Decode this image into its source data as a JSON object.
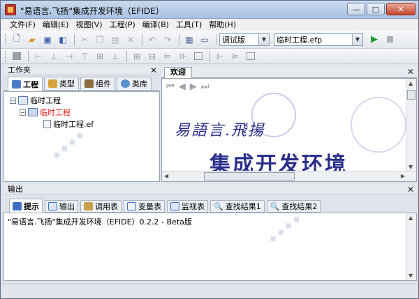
{
  "window": {
    "title": "\"易语言.飞扬\"集成开发环境（EFIDE）"
  },
  "window_controls": {
    "minimize": "—",
    "maximize": "□",
    "close": "✕"
  },
  "menu": [
    "文件(F)",
    "编辑(E)",
    "视图(V)",
    "工程(P)",
    "编译(B)",
    "工具(T)",
    "帮助(H)"
  ],
  "toolbar": {
    "config_combo": "调试版",
    "project_combo": "临时工程.efp",
    "run_glyph": "▶"
  },
  "workspace": {
    "title": "工作夹",
    "tabs": [
      {
        "label": "工程",
        "icon": "project-icon",
        "active": true,
        "color": "#4a7cc7"
      },
      {
        "label": "类型",
        "icon": "type-icon",
        "active": false,
        "color": "#d9a33a"
      },
      {
        "label": "组件",
        "icon": "component-icon",
        "active": false,
        "color": "#8b6a3d"
      },
      {
        "label": "类库",
        "icon": "library-icon",
        "active": false,
        "color": "#5a8fcf"
      }
    ],
    "tree": [
      {
        "label": "临时工程",
        "level": 0,
        "expander": "−",
        "color": "#000000"
      },
      {
        "label": "临时工程",
        "level": 1,
        "expander": "−",
        "color": "#e02020"
      },
      {
        "label": "临时工程.ef",
        "level": 2,
        "expander": "",
        "color": "#000000"
      }
    ]
  },
  "welcome": {
    "tab": "欢迎",
    "logo_small": "易語言.飛揚",
    "logo_big": "集成开发环境"
  },
  "output": {
    "title": "输出",
    "tabs": [
      {
        "label": "提示",
        "icon": "hint-icon",
        "active": true
      },
      {
        "label": "输出",
        "icon": "output-icon",
        "active": false
      },
      {
        "label": "调用表",
        "icon": "callstack-icon",
        "active": false
      },
      {
        "label": "变量表",
        "icon": "variables-icon",
        "active": false
      },
      {
        "label": "监视表",
        "icon": "watch-icon",
        "active": false
      },
      {
        "label": "查找结果1",
        "icon": "find-icon",
        "active": false
      },
      {
        "label": "查找结果2",
        "icon": "find-icon",
        "active": false
      }
    ],
    "message": "\"易语言.飞扬\"集成开发环境（EFIDE）0.2.2 - Beta版"
  },
  "colors": {
    "accent": "#2a2f8a",
    "highlight": "#e02020"
  }
}
